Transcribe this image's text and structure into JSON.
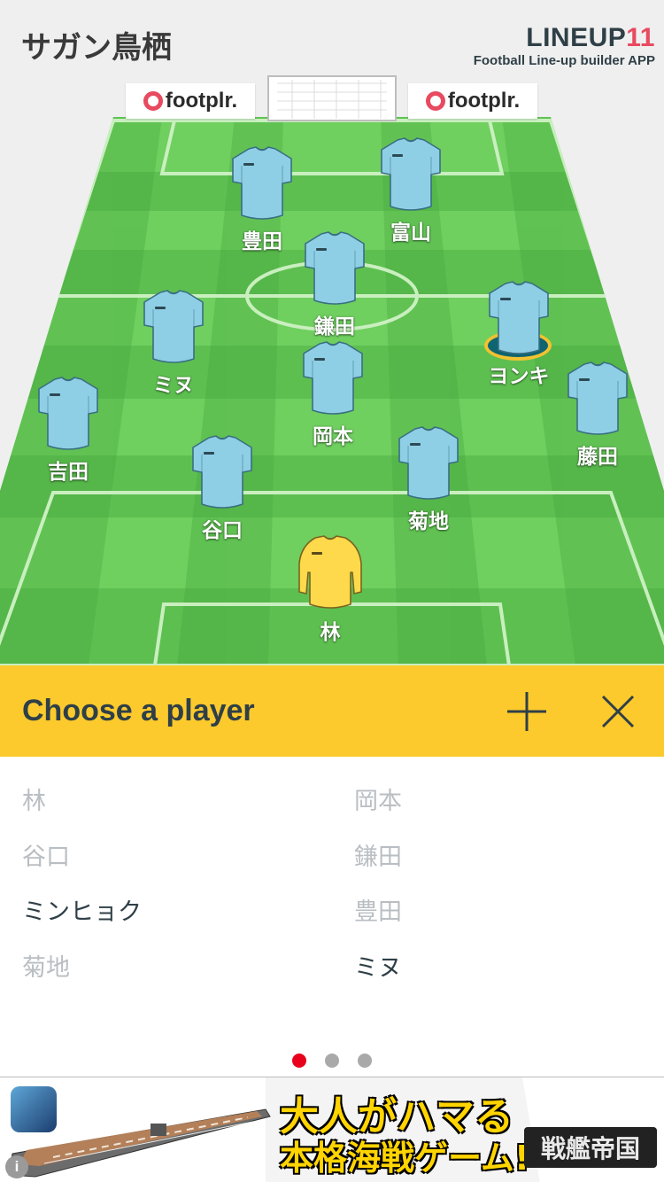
{
  "header": {
    "team_name": "サガン鳥栖",
    "brand_main": "LINEUP",
    "brand_number": "11",
    "brand_tagline": "Football Line-up builder APP"
  },
  "sponsors": {
    "left": "footplr.",
    "right": "footplr."
  },
  "pitch_players": [
    {
      "name": "豊田",
      "role": "field",
      "selected": false
    },
    {
      "name": "富山",
      "role": "field",
      "selected": false
    },
    {
      "name": "鎌田",
      "role": "field",
      "selected": false
    },
    {
      "name": "ミヌ",
      "role": "field",
      "selected": false
    },
    {
      "name": "ヨンキ",
      "role": "field",
      "selected": true
    },
    {
      "name": "岡本",
      "role": "field",
      "selected": false
    },
    {
      "name": "吉田",
      "role": "field",
      "selected": false
    },
    {
      "name": "藤田",
      "role": "field",
      "selected": false
    },
    {
      "name": "谷口",
      "role": "field",
      "selected": false
    },
    {
      "name": "菊地",
      "role": "field",
      "selected": false
    },
    {
      "name": "林",
      "role": "goalkeeper",
      "selected": false
    }
  ],
  "colors": {
    "field_shirt": "#8ecfe6",
    "goalkeeper_shirt": "#fdd94b",
    "pitch_light": "#6fcf5f",
    "pitch_dark": "#52b545",
    "choose_bar": "#fcca2c",
    "dot_active": "#e8001c"
  },
  "chooser": {
    "title": "Choose a player",
    "add_icon": "plus-icon",
    "close_icon": "close-icon",
    "players": [
      {
        "name": "林",
        "state": "used"
      },
      {
        "name": "岡本",
        "state": "used"
      },
      {
        "name": "谷口",
        "state": "used"
      },
      {
        "name": "鎌田",
        "state": "used"
      },
      {
        "name": "ミンヒョク",
        "state": "available"
      },
      {
        "name": "豊田",
        "state": "used"
      },
      {
        "name": "菊地",
        "state": "used"
      },
      {
        "name": "ミヌ",
        "state": "available"
      }
    ]
  },
  "pagination": {
    "pages": 3,
    "current": 1
  },
  "ad": {
    "headline_1": "大人がハマる",
    "headline_2": "本格海戦ゲーム!",
    "brand": "戦艦帝国",
    "info_icon": "info-icon"
  }
}
